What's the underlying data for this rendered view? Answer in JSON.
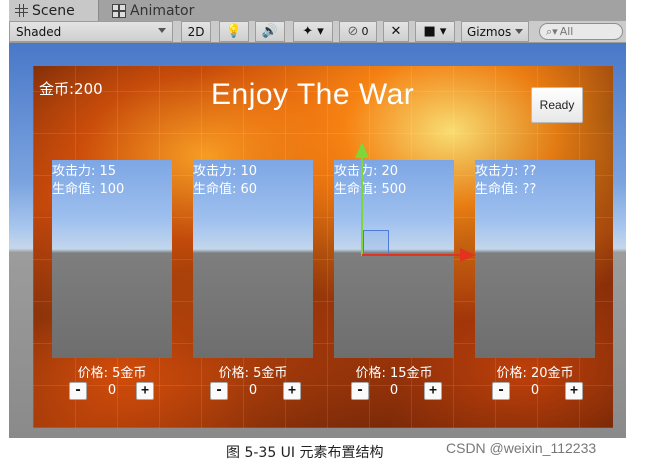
{
  "tabs": [
    {
      "label": "Scene",
      "icon": "grid-icon"
    },
    {
      "label": "Animator",
      "icon": "animator-icon"
    }
  ],
  "toolbar": {
    "shading_mode": "Shaded",
    "mode_2d": "2D",
    "hidden_count": "0",
    "gizmos": "Gizmos",
    "search_placeholder": "All"
  },
  "game": {
    "gold_label": "金币:200",
    "title": "Enjoy The War",
    "ready_button": "Ready",
    "cards": [
      {
        "attack": "攻击力: 15",
        "hp": "生命值: 100",
        "price": "价格: 5金币",
        "qty": "0"
      },
      {
        "attack": "攻击力: 10",
        "hp": "生命值: 60",
        "price": "价格: 5金币",
        "qty": "0"
      },
      {
        "attack": "攻击力: 20",
        "hp": "生命值: 500",
        "price": "价格: 15金币",
        "qty": "0"
      },
      {
        "attack": "攻击力: ??",
        "hp": "生命值: ??",
        "price": "价格: 20金币",
        "qty": "0"
      }
    ],
    "minus": "-",
    "plus": "+"
  },
  "caption": "图 5-35 UI 元素布置结构",
  "watermark": "CSDN @weixin_112233"
}
